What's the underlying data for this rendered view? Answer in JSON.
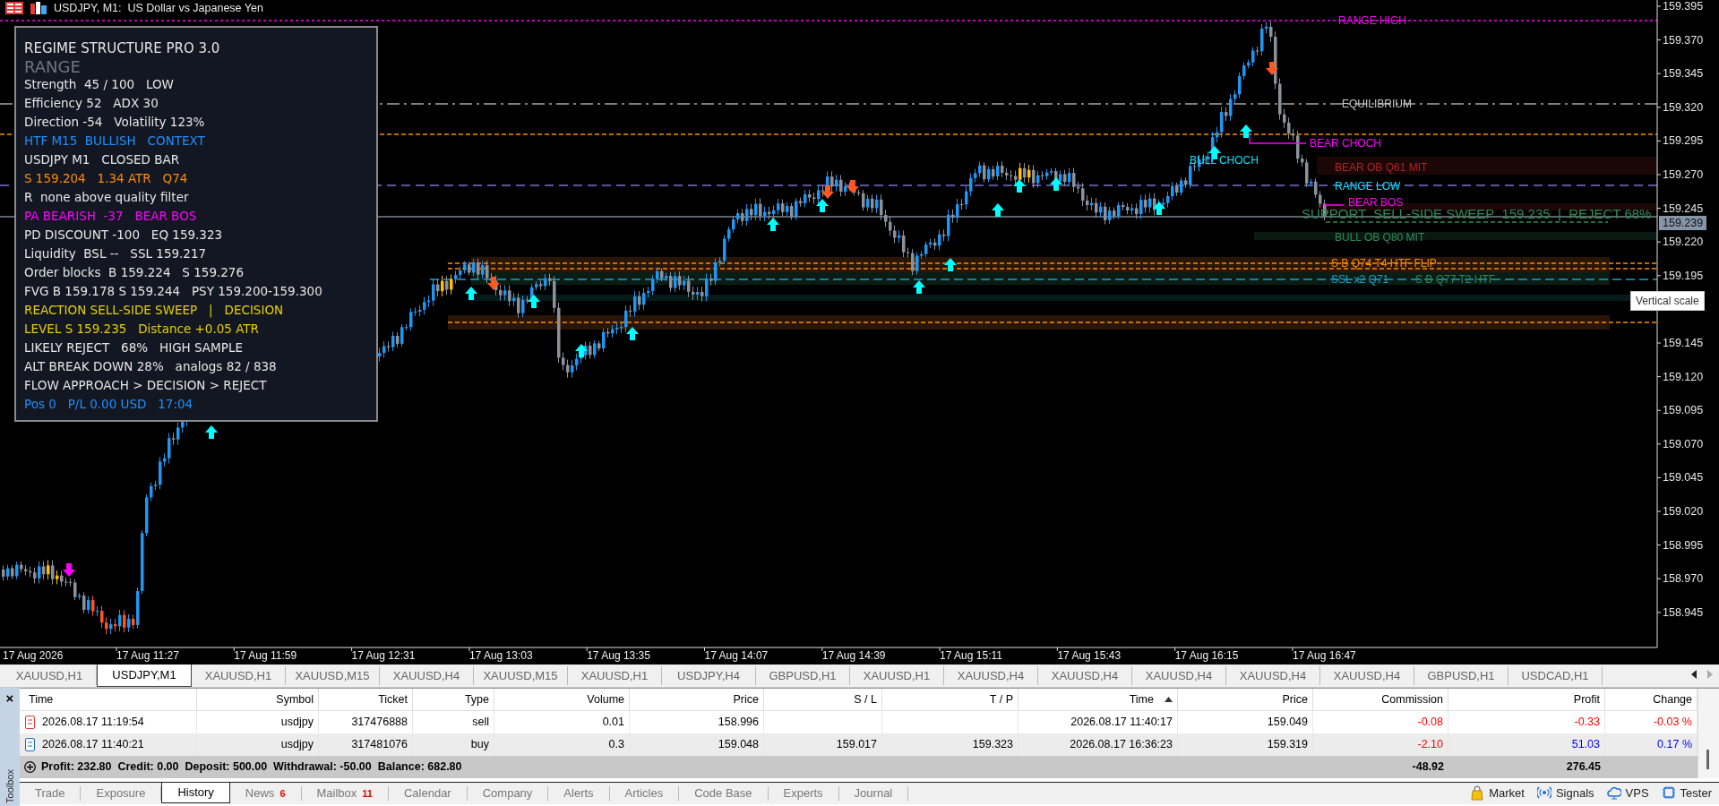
{
  "window": {
    "title": "USDJPY, M1:  US Dollar vs Japanese Yen"
  },
  "chart": {
    "price_scale": [
      "159.395",
      "159.370",
      "159.345",
      "159.320",
      "159.295",
      "159.270",
      "159.245",
      "159.220",
      "159.195",
      "159.145",
      "159.120",
      "159.095",
      "159.070",
      "159.045",
      "159.020",
      "158.995",
      "158.970",
      "158.945"
    ],
    "current_price": "159.239",
    "time_scale": [
      "17 Aug 2026",
      "17 Aug 11:27",
      "17 Aug 11:59",
      "17 Aug 12:31",
      "17 Aug 13:03",
      "17 Aug 13:35",
      "17 Aug 14:07",
      "17 Aug 14:39",
      "17 Aug 15:11",
      "17 Aug 15:43",
      "17 Aug 16:15",
      "17 Aug 16:47"
    ],
    "labels": [
      {
        "text": "RANGE HIGH",
        "color": "#ff00ff"
      },
      {
        "text": "EQUILIBRIUM",
        "color": "#c8c8c8"
      },
      {
        "text": "BEAR CHOCH",
        "color": "#ff00ff"
      },
      {
        "text": "BULL CHOCH",
        "color": "#00e5ff"
      },
      {
        "text": "BEAR OB Q61 MIT",
        "color": "#b22222"
      },
      {
        "text": "RANGE LOW",
        "color": "#00e5ff"
      },
      {
        "text": "BEAR BOS",
        "color": "#ff00ff"
      },
      {
        "text": "SUPPORT  SELL-SIDE SWEEP  159.235  |  REJECT 68%",
        "color": "#2e8b57"
      },
      {
        "text": "BULL OB Q80 MIT",
        "color": "#2e8b57"
      },
      {
        "text": "S B Q74 T4 HTF FLIP",
        "color": "#ff8c00"
      },
      {
        "text": "SSL x2 Q71",
        "color": "#1ca0c8"
      },
      {
        "text": "S B Q77 T2 HTF",
        "color": "#2e8b57"
      }
    ],
    "tooltip": "Vertical scale"
  },
  "indicator_panel": {
    "title": "REGIME STRUCTURE PRO 3.0",
    "regime": "RANGE",
    "lines": [
      {
        "text": "Strength  45 / 100   LOW",
        "color": "#e6e6e6"
      },
      {
        "text": "Efficiency 52   ADX 30",
        "color": "#e6e6e6"
      },
      {
        "text": "Direction -54   Volatility 123%",
        "color": "#e6e6e6"
      },
      {
        "text": "HTF M15  BULLISH   CONTEXT",
        "color": "#1e90ff"
      },
      {
        "text": "USDJPY M1   CLOSED BAR",
        "color": "#e6e6e6"
      },
      {
        "text": "S 159.204   1.34 ATR   Q74",
        "color": "#ff8c00"
      },
      {
        "text": "R  none above quality filter",
        "color": "#e6e6e6"
      },
      {
        "text": "PA BEARISH  -37   BEAR BOS",
        "color": "#ff00ff"
      },
      {
        "text": "PD DISCOUNT -100   EQ 159.323",
        "color": "#e6e6e6"
      },
      {
        "text": "Liquidity  BSL --   SSL 159.217",
        "color": "#e6e6e6"
      },
      {
        "text": "Order blocks  B 159.224   S 159.276",
        "color": "#e6e6e6"
      },
      {
        "text": "FVG B 159.178 S 159.244   PSY 159.200-159.300",
        "color": "#e6e6e6"
      },
      {
        "text": "REACTION SELL-SIDE SWEEP   |   DECISION",
        "color": "#e6d000"
      },
      {
        "text": "LEVEL S 159.235   Distance +0.05 ATR",
        "color": "#e6d000"
      },
      {
        "text": "LIKELY REJECT   68%   HIGH SAMPLE",
        "color": "#e6e6e6"
      },
      {
        "text": "ALT BREAK DOWN 28%   analogs 82 / 838",
        "color": "#e6e6e6"
      },
      {
        "text": "FLOW APPROACH > DECISION > REJECT",
        "color": "#e6e6e6"
      },
      {
        "text": "Pos 0   P/L 0.00 USD   17:04",
        "color": "#1e90ff"
      }
    ]
  },
  "symbol_tabs": [
    {
      "label": "XAUUSD,H1",
      "selected": false
    },
    {
      "label": "USDJPY,M1",
      "selected": true
    },
    {
      "label": "XAUUSD,H1",
      "selected": false
    },
    {
      "label": "XAUUSD,M15",
      "selected": false
    },
    {
      "label": "XAUUSD,H4",
      "selected": false
    },
    {
      "label": "XAUUSD,M15",
      "selected": false
    },
    {
      "label": "XAUUSD,H1",
      "selected": false
    },
    {
      "label": "USDJPY,H4",
      "selected": false
    },
    {
      "label": "GBPUSD,H1",
      "selected": false
    },
    {
      "label": "XAUUSD,H1",
      "selected": false
    },
    {
      "label": "XAUUSD,H4",
      "selected": false
    },
    {
      "label": "XAUUSD,H4",
      "selected": false
    },
    {
      "label": "XAUUSD,H4",
      "selected": false
    },
    {
      "label": "XAUUSD,H4",
      "selected": false
    },
    {
      "label": "XAUUSD,H4",
      "selected": false
    },
    {
      "label": "GBPUSD,H1",
      "selected": false
    },
    {
      "label": "USDCAD,H1",
      "selected": false
    }
  ],
  "toolbox": {
    "title": "Toolbox",
    "close": "×",
    "columns": [
      {
        "label": "Time",
        "sorted": false
      },
      {
        "label": "Symbol",
        "sorted": false
      },
      {
        "label": "Ticket",
        "sorted": false
      },
      {
        "label": "Type",
        "sorted": false
      },
      {
        "label": "Volume",
        "sorted": false
      },
      {
        "label": "Price",
        "sorted": false
      },
      {
        "label": "S / L",
        "sorted": false
      },
      {
        "label": "T / P",
        "sorted": false
      },
      {
        "label": "Time",
        "sorted": true
      },
      {
        "label": "Price",
        "sorted": false
      },
      {
        "label": "Commission",
        "sorted": false
      },
      {
        "label": "Profit",
        "sorted": false
      },
      {
        "label": "Change",
        "sorted": false
      }
    ],
    "rows": [
      {
        "kind": "sell",
        "color": "#ff0000",
        "cells": [
          "2026.08.17 11:19:54",
          "usdjpy",
          "317476888",
          "sell",
          "0.01",
          "158.996",
          "",
          "",
          "2026.08.17 11:40:17",
          "159.049",
          "-0.08",
          "-0.33",
          "-0.03 %"
        ]
      },
      {
        "kind": "buy",
        "color": "#0000ff",
        "cells": [
          "2026.08.17 11:40:21",
          "usdjpy",
          "317481076",
          "buy",
          "0.3",
          "159.048",
          "159.017",
          "159.323",
          "2026.08.17 16:36:23",
          "159.319",
          "-2.10",
          "51.03",
          "0.17 %"
        ]
      }
    ],
    "summary": {
      "text": "Profit: 232.80  Credit: 0.00  Deposit: 500.00  Withdrawal: -50.00  Balance: 682.80",
      "commission": "-48.92",
      "profit": "276.45"
    },
    "tabs": [
      {
        "label": "Trade",
        "selected": false
      },
      {
        "label": "Exposure",
        "selected": false
      },
      {
        "label": "History",
        "selected": true
      },
      {
        "label": "News",
        "badge": "6",
        "selected": false
      },
      {
        "label": "Mailbox",
        "badge": "11",
        "selected": false
      },
      {
        "label": "Calendar",
        "selected": false
      },
      {
        "label": "Company",
        "selected": false
      },
      {
        "label": "Alerts",
        "selected": false
      },
      {
        "label": "Articles",
        "selected": false
      },
      {
        "label": "Code Base",
        "selected": false
      },
      {
        "label": "Experts",
        "selected": false
      },
      {
        "label": "Journal",
        "selected": false
      }
    ],
    "services": [
      {
        "kind": "market",
        "label": "Market"
      },
      {
        "kind": "signals",
        "label": "Signals"
      },
      {
        "kind": "vps",
        "label": "VPS"
      },
      {
        "kind": "tester",
        "label": "Tester"
      }
    ]
  }
}
